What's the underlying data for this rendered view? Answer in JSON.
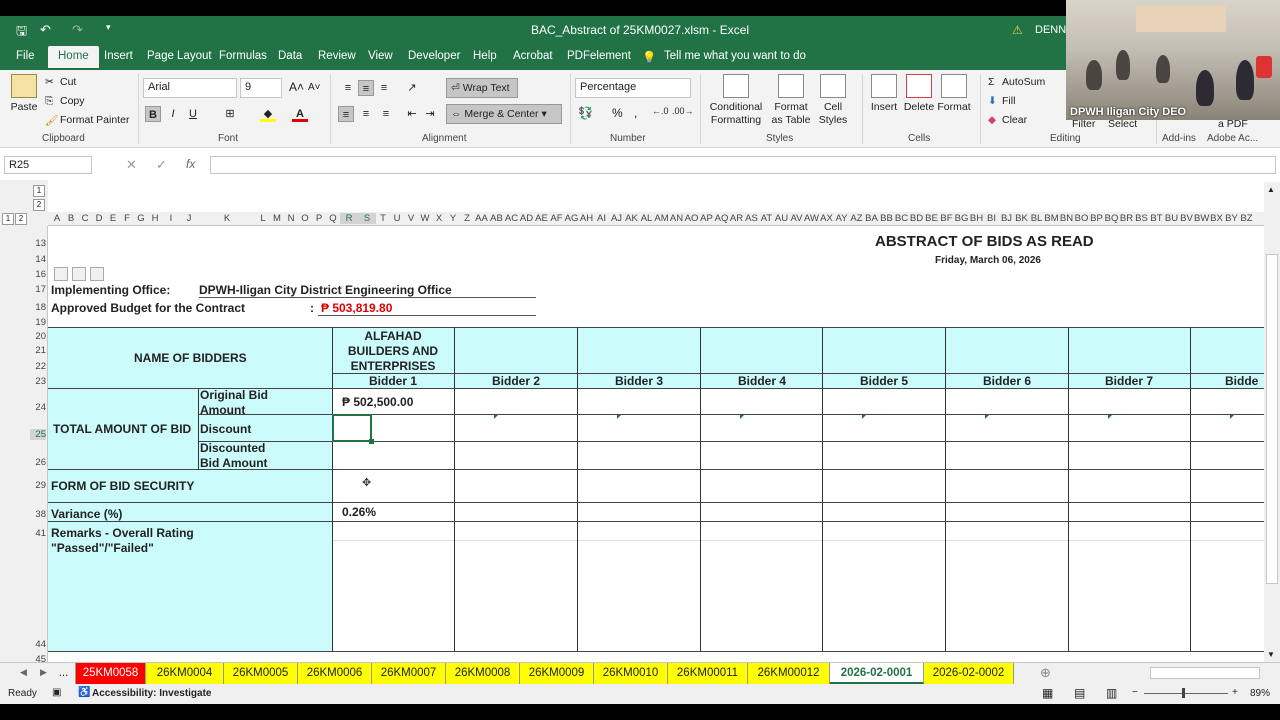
{
  "window": {
    "title": "BAC_Abstract of 25KM0027.xlsm  -  Excel",
    "user": "DENNIS"
  },
  "ribbon_tabs": [
    "File",
    "Home",
    "Insert",
    "Page Layout",
    "Formulas",
    "Data",
    "Review",
    "View",
    "Developer",
    "Help",
    "Acrobat",
    "PDFelement"
  ],
  "tell_me": "Tell me what you want to do",
  "clipboard": {
    "paste": "Paste",
    "cut": "Cut",
    "copy": "Copy",
    "format_painter": "Format Painter",
    "group": "Clipboard"
  },
  "font": {
    "name": "Arial",
    "size": "9",
    "group": "Font"
  },
  "alignment": {
    "wrap": "Wrap Text",
    "merge": "Merge & Center",
    "group": "Alignment"
  },
  "number": {
    "format": "Percentage",
    "group": "Number"
  },
  "styles": {
    "conditional": "Conditional Formatting",
    "format_table": "Format as Table",
    "cell_styles": "Cell Styles",
    "group": "Styles"
  },
  "cells": {
    "insert": "Insert",
    "delete": "Delete",
    "format": "Format",
    "group": "Cells"
  },
  "editing": {
    "autosum": "AutoSum",
    "fill": "Fill",
    "clear": "Clear",
    "filter": "Filter",
    "select": "Select",
    "group": "Editing"
  },
  "addins": {
    "group": "Add-ins",
    "adobe": "Adobe Ac...",
    "pdf": "a PDF"
  },
  "name_box": "R25",
  "columns": [
    "A",
    "B",
    "C",
    "D",
    "E",
    "F",
    "G",
    "H",
    "I",
    "J",
    "K",
    "L",
    "M",
    "N",
    "O",
    "P",
    "Q",
    "R",
    "S",
    "T",
    "U",
    "V",
    "W",
    "X",
    "Y",
    "Z",
    "AA",
    "AB",
    "AC",
    "AD",
    "AE",
    "AF",
    "AG",
    "AH",
    "AI",
    "AJ",
    "AK",
    "AL",
    "AM",
    "AN",
    "AO",
    "AP",
    "AQ",
    "AR",
    "AS",
    "AT",
    "AU",
    "AV",
    "AW",
    "AX",
    "AY",
    "AZ",
    "BA",
    "BB",
    "BC",
    "BD",
    "BE",
    "BF",
    "BG",
    "BH",
    "BI",
    "BJ",
    "BK",
    "BL",
    "BM",
    "BN",
    "BO",
    "BP",
    "BQ",
    "BR",
    "BS",
    "BT",
    "BU",
    "BV",
    "BW",
    "BX",
    "BY",
    "BZ"
  ],
  "rows": [
    "13",
    "14",
    "16",
    "17",
    "18",
    "19",
    "20",
    "21",
    "22",
    "23",
    "24",
    "25",
    "26",
    "29",
    "38",
    "41",
    "44",
    "45"
  ],
  "sheet": {
    "title": "ABSTRACT OF BIDS AS READ",
    "date": "Friday, March 06, 2026",
    "office_label": "Implementing Office:",
    "office_value": "DPWH-Iligan City District Engineering Office",
    "abc_label": "Approved Budget for the Contract",
    "abc_colon": ":",
    "abc_value": "₱ 503,819.80",
    "name_of_bidders": "NAME OF BIDDERS",
    "bidder1_name": "ALFAHAD BUILDERS AND ENTERPRISES",
    "bidders": [
      "Bidder 1",
      "Bidder 2",
      "Bidder 3",
      "Bidder 4",
      "Bidder 5",
      "Bidder 6",
      "Bidder 7",
      "Bidde"
    ],
    "total_amount": "TOTAL AMOUNT OF BID",
    "original": "Original Bid Amount",
    "discount": "Discount",
    "discounted": "Discounted Bid Amount",
    "original_value": "₱  502,500.00",
    "form_security": "FORM OF BID SECURITY",
    "variance": "Variance (%)",
    "variance_value": "0.26%",
    "remarks": "Remarks - Overall Rating \"Passed\"/\"Failed\""
  },
  "sheet_tabs": [
    "...",
    "25KM0058",
    "26KM0004",
    "26KM0005",
    "26KM0006",
    "26KM0007",
    "26KM0008",
    "26KM0009",
    "26KM0010",
    "26KM00011",
    "26KM00012",
    "2026-02-0001",
    "2026-02-0002"
  ],
  "status": {
    "ready": "Ready",
    "accessibility": "Accessibility: Investigate",
    "zoom": "89%"
  },
  "video": {
    "label": "DPWH Iligan City DEO"
  },
  "colors": {
    "excel_green": "#217346",
    "cyan_fill": "#ccfbfb",
    "red_tab": "#ff0000",
    "yellow_tab": "#ffff00",
    "abc_red": "#e00000"
  }
}
